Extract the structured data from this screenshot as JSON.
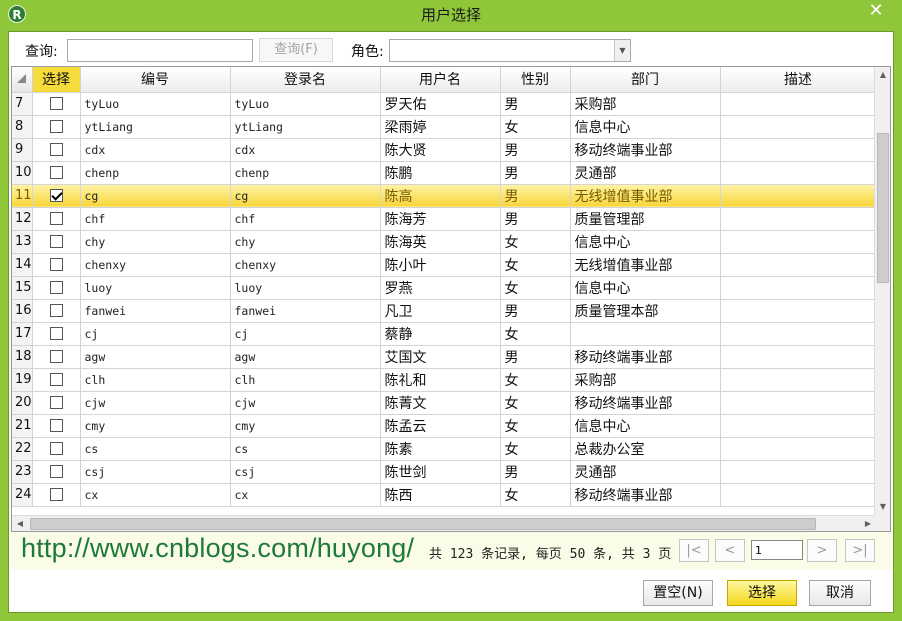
{
  "window": {
    "title": "用户选择",
    "app_icon_letter": "R",
    "close_glyph": "✕"
  },
  "toolbar": {
    "query_label": "查询:",
    "query_value": "",
    "query_button": "查询(F)",
    "role_label": "角色:",
    "role_value": ""
  },
  "table": {
    "columns": [
      "选择",
      "编号",
      "登录名",
      "用户名",
      "性别",
      "部门",
      "描述"
    ],
    "rows": [
      {
        "n": "7",
        "checked": false,
        "id": "tyLuo",
        "login": "tyLuo",
        "name": "罗天佑",
        "sex": "男",
        "dept": "采购部",
        "desc": ""
      },
      {
        "n": "8",
        "checked": false,
        "id": "ytLiang",
        "login": "ytLiang",
        "name": "梁雨婷",
        "sex": "女",
        "dept": "信息中心",
        "desc": ""
      },
      {
        "n": "9",
        "checked": false,
        "id": "cdx",
        "login": "cdx",
        "name": "陈大贤",
        "sex": "男",
        "dept": "移动终端事业部",
        "desc": ""
      },
      {
        "n": "10",
        "checked": false,
        "id": "chenp",
        "login": "chenp",
        "name": "陈鹏",
        "sex": "男",
        "dept": "灵通部",
        "desc": ""
      },
      {
        "n": "11",
        "checked": true,
        "id": "cg",
        "login": "cg",
        "name": "陈高",
        "sex": "男",
        "dept": "无线增值事业部",
        "desc": ""
      },
      {
        "n": "12",
        "checked": false,
        "id": "chf",
        "login": "chf",
        "name": "陈海芳",
        "sex": "男",
        "dept": "质量管理部",
        "desc": ""
      },
      {
        "n": "13",
        "checked": false,
        "id": "chy",
        "login": "chy",
        "name": "陈海英",
        "sex": "女",
        "dept": "信息中心",
        "desc": ""
      },
      {
        "n": "14",
        "checked": false,
        "id": "chenxy",
        "login": "chenxy",
        "name": "陈小叶",
        "sex": "女",
        "dept": "无线增值事业部",
        "desc": ""
      },
      {
        "n": "15",
        "checked": false,
        "id": "luoy",
        "login": "luoy",
        "name": "罗燕",
        "sex": "女",
        "dept": "信息中心",
        "desc": ""
      },
      {
        "n": "16",
        "checked": false,
        "id": "fanwei",
        "login": "fanwei",
        "name": "凡卫",
        "sex": "男",
        "dept": "质量管理本部",
        "desc": ""
      },
      {
        "n": "17",
        "checked": false,
        "id": "cj",
        "login": "cj",
        "name": "蔡静",
        "sex": "女",
        "dept": "",
        "desc": ""
      },
      {
        "n": "18",
        "checked": false,
        "id": "agw",
        "login": "agw",
        "name": "艾国文",
        "sex": "男",
        "dept": "移动终端事业部",
        "desc": ""
      },
      {
        "n": "19",
        "checked": false,
        "id": "clh",
        "login": "clh",
        "name": "陈礼和",
        "sex": "女",
        "dept": "采购部",
        "desc": ""
      },
      {
        "n": "20",
        "checked": false,
        "id": "cjw",
        "login": "cjw",
        "name": "陈菁文",
        "sex": "女",
        "dept": "移动终端事业部",
        "desc": ""
      },
      {
        "n": "21",
        "checked": false,
        "id": "cmy",
        "login": "cmy",
        "name": "陈孟云",
        "sex": "女",
        "dept": "信息中心",
        "desc": ""
      },
      {
        "n": "22",
        "checked": false,
        "id": "cs",
        "login": "cs",
        "name": "陈素",
        "sex": "女",
        "dept": "总裁办公室",
        "desc": ""
      },
      {
        "n": "23",
        "checked": false,
        "id": "csj",
        "login": "csj",
        "name": "陈世剑",
        "sex": "男",
        "dept": "灵通部",
        "desc": ""
      },
      {
        "n": "24",
        "checked": false,
        "id": "cx",
        "login": "cx",
        "name": "陈西",
        "sex": "女",
        "dept": "移动终端事业部",
        "desc": ""
      }
    ],
    "selected_row": "11"
  },
  "pager": {
    "watermark": "http://www.cnblogs.com/huyong/",
    "info": "共 123 条记录, 每页 50 条, 共 3 页",
    "page_value": "1",
    "first_glyph": "|<",
    "prev_glyph": "<",
    "next_glyph": ">",
    "last_glyph": ">|"
  },
  "footer": {
    "clear_button": "置空(N)",
    "select_button": "选择",
    "cancel_button": "取消"
  },
  "colors": {
    "frame": "#8fc63a",
    "selection": "#f5dc3c"
  }
}
